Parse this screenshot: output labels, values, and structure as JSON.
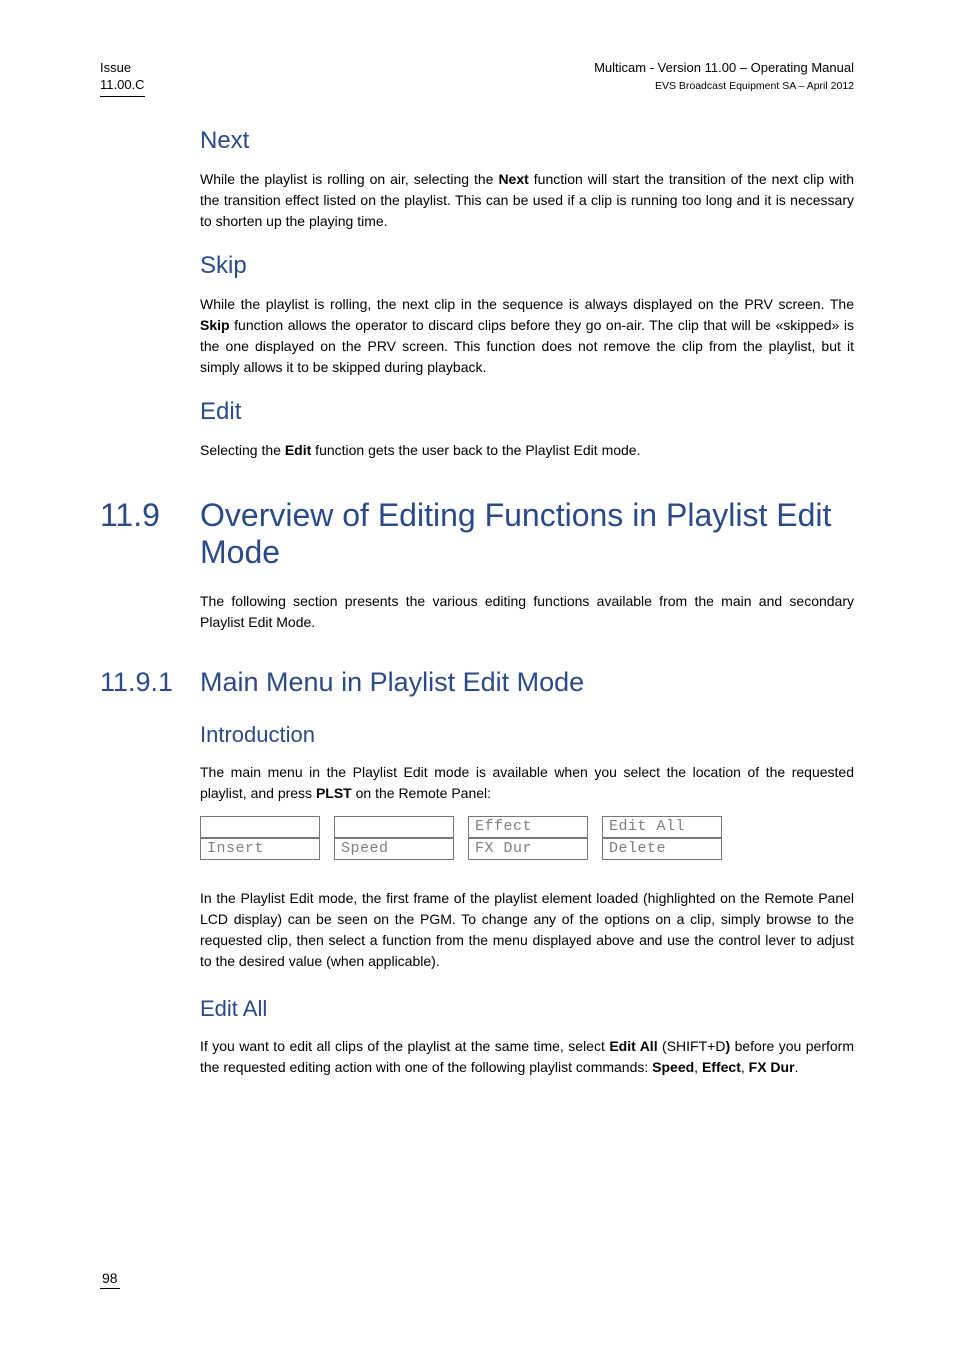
{
  "header": {
    "issue_label": "Issue",
    "issue_value": "11.00.C",
    "title": "Multicam - Version 11.00 – Operating Manual",
    "subtitle": "EVS Broadcast Equipment SA – April 2012"
  },
  "sections": {
    "next": {
      "title": "Next",
      "p1a": "While the playlist is rolling on air, selecting the ",
      "p1b": "Next",
      "p1c": " function will start the transition of the next clip with the transition effect listed on the playlist. This can be used if a clip is running too long and it is necessary to shorten up the playing time."
    },
    "skip": {
      "title": "Skip",
      "p1a": "While the playlist is rolling, the next clip in the sequence is always displayed on the PRV screen. The ",
      "p1b": "Skip",
      "p1c": " function allows the operator to discard clips before they go on-air. The clip that will be «skipped» is the one displayed on the PRV screen. This function does not remove the clip from the playlist, but it simply allows it to be skipped during playback."
    },
    "edit": {
      "title": "Edit",
      "p1a": "Selecting the ",
      "p1b": "Edit",
      "p1c": " function gets the user back to the Playlist Edit mode."
    },
    "overview": {
      "num": "11.9",
      "title": "Overview of Editing Functions in Playlist Edit Mode",
      "p1": "The following section presents the various editing functions available from the main and secondary Playlist Edit Mode."
    },
    "mainmenu": {
      "num": "11.9.1",
      "title": "Main Menu in Playlist Edit Mode"
    },
    "intro": {
      "title": "Introduction",
      "p1a": "The main menu in the Playlist Edit mode is available when you select the location of the requested playlist, and press ",
      "p1b": "PLST",
      "p1c": " on the Remote Panel:",
      "p2": "In the Playlist Edit mode, the first frame of the playlist element loaded (highlighted on the Remote Panel LCD display) can be seen on the PGM. To change any of the options on a clip, simply browse to the requested clip, then select a function from the menu displayed above and use the control lever to adjust to the desired value (when applicable)."
    },
    "menu": {
      "r1c1": "",
      "r1c2": "",
      "r1c3": "Effect",
      "r1c4": "Edit All",
      "r2c1": "Insert",
      "r2c2": "Speed",
      "r2c3": "FX Dur",
      "r2c4": "Delete"
    },
    "editall": {
      "title": "Edit All",
      "p1a": "If you want to edit all clips of the playlist at the same time, select ",
      "p1b": "Edit All",
      "p1c": " (SHIFT+D",
      "p1d": ")",
      "p1e": " before you perform the requested editing action with one of the following playlist commands: ",
      "p1f": "Speed",
      "p1g": ", ",
      "p1h": "Effect",
      "p1i": ", ",
      "p1j": "FX Dur",
      "p1k": "."
    }
  },
  "footer": {
    "page": "98"
  }
}
